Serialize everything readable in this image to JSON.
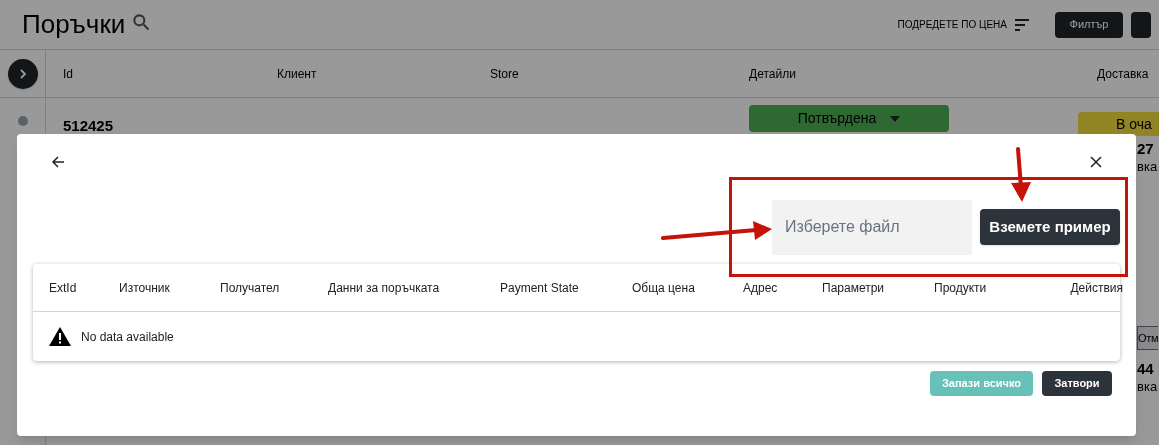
{
  "page": {
    "title": "Поръчки",
    "sort_label": "ПОДРЕДЕТЕ ПО ЦЕНА",
    "filter_button": "Филтър",
    "columns": [
      "Id",
      "Клиент",
      "Store",
      "Детайли",
      "Доставка"
    ],
    "order": {
      "id": "512425",
      "status": "Потвърдена",
      "delivery": "В оча"
    },
    "fragments": [
      {
        "kind": "number",
        "text": "27"
      },
      {
        "kind": "word",
        "text": "вка"
      },
      {
        "kind": "badge",
        "text": "Отм"
      },
      {
        "kind": "number",
        "text": "44"
      },
      {
        "kind": "word",
        "text": "вка"
      }
    ]
  },
  "modal": {
    "file_field": {
      "placeholder": "Изберете файл"
    },
    "example_button": "Вземете пример",
    "table": {
      "columns": [
        "ExtId",
        "Източник",
        "Получател",
        "Данни за поръчката",
        "Payment State",
        "Обща цена",
        "Адрес",
        "Параметри",
        "Продукти",
        "Действия"
      ],
      "empty_text": "No data available"
    },
    "buttons": [
      {
        "kind": "save",
        "label": "Запази всичко",
        "disabled": true
      },
      {
        "kind": "close",
        "label": "Затвори",
        "disabled": false
      }
    ]
  }
}
